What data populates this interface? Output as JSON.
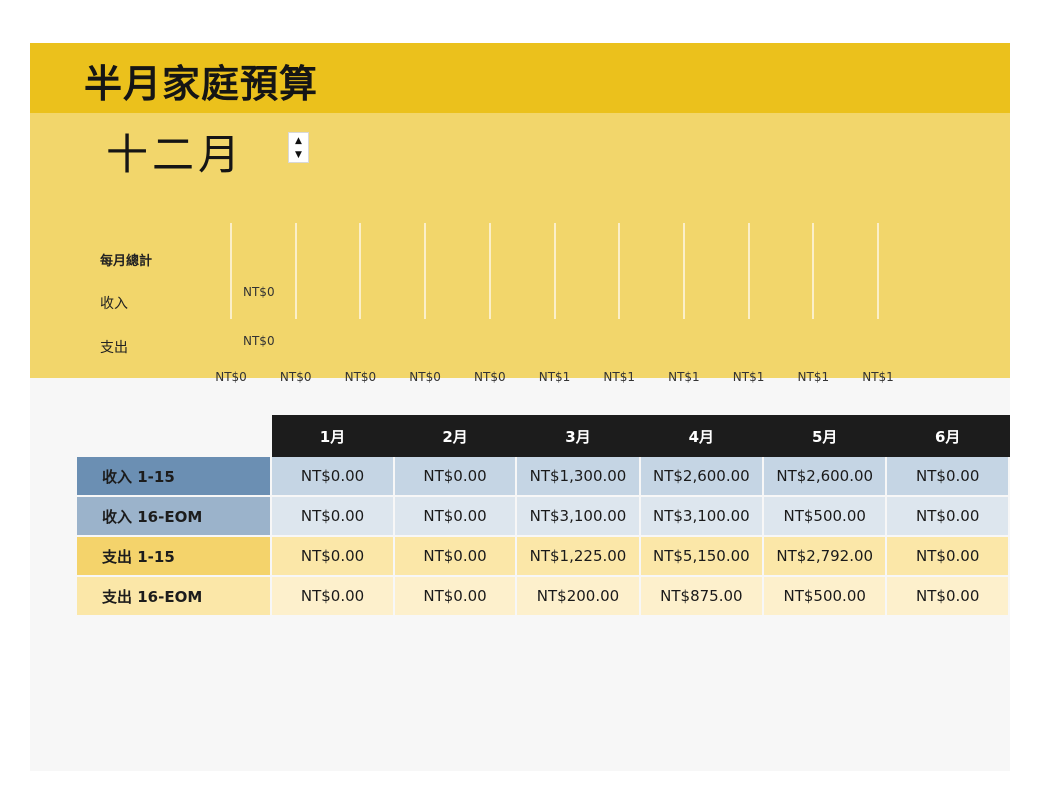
{
  "title": "半月家庭預算",
  "month": {
    "value": "十二月",
    "spin_up": "▲",
    "spin_down": "▼"
  },
  "summary": {
    "heading": "每月總計",
    "income_label": "收入",
    "expense_label": "支出",
    "income_value": "NT$0",
    "expense_value": "NT$0",
    "axis_ticks": [
      "NT$0",
      "NT$0",
      "NT$0",
      "NT$0",
      "NT$0",
      "NT$1",
      "NT$1",
      "NT$1",
      "NT$1",
      "NT$1",
      "NT$1"
    ]
  },
  "table": {
    "months": [
      "1月",
      "2月",
      "3月",
      "4月",
      "5月",
      "6月"
    ],
    "rows": [
      {
        "label": "收入 1-15",
        "values": [
          "NT$0.00",
          "NT$0.00",
          "NT$1,300.00",
          "NT$2,600.00",
          "NT$2,600.00",
          "NT$0.00"
        ]
      },
      {
        "label": "收入 16-EOM",
        "values": [
          "NT$0.00",
          "NT$0.00",
          "NT$3,100.00",
          "NT$3,100.00",
          "NT$500.00",
          "NT$0.00"
        ]
      },
      {
        "label": "支出 1-15",
        "values": [
          "NT$0.00",
          "NT$0.00",
          "NT$1,225.00",
          "NT$5,150.00",
          "NT$2,792.00",
          "NT$0.00"
        ]
      },
      {
        "label": "支出 16-EOM",
        "values": [
          "NT$0.00",
          "NT$0.00",
          "NT$200.00",
          "NT$875.00",
          "NT$500.00",
          "NT$0.00"
        ]
      }
    ]
  },
  "colors": {
    "title_bar": "#ebc11c",
    "summary_bg": "#f2d66b",
    "header_bg": "#1c1c1c",
    "income_label": "#6b8fb3",
    "expense_label": "#f4d36b"
  }
}
